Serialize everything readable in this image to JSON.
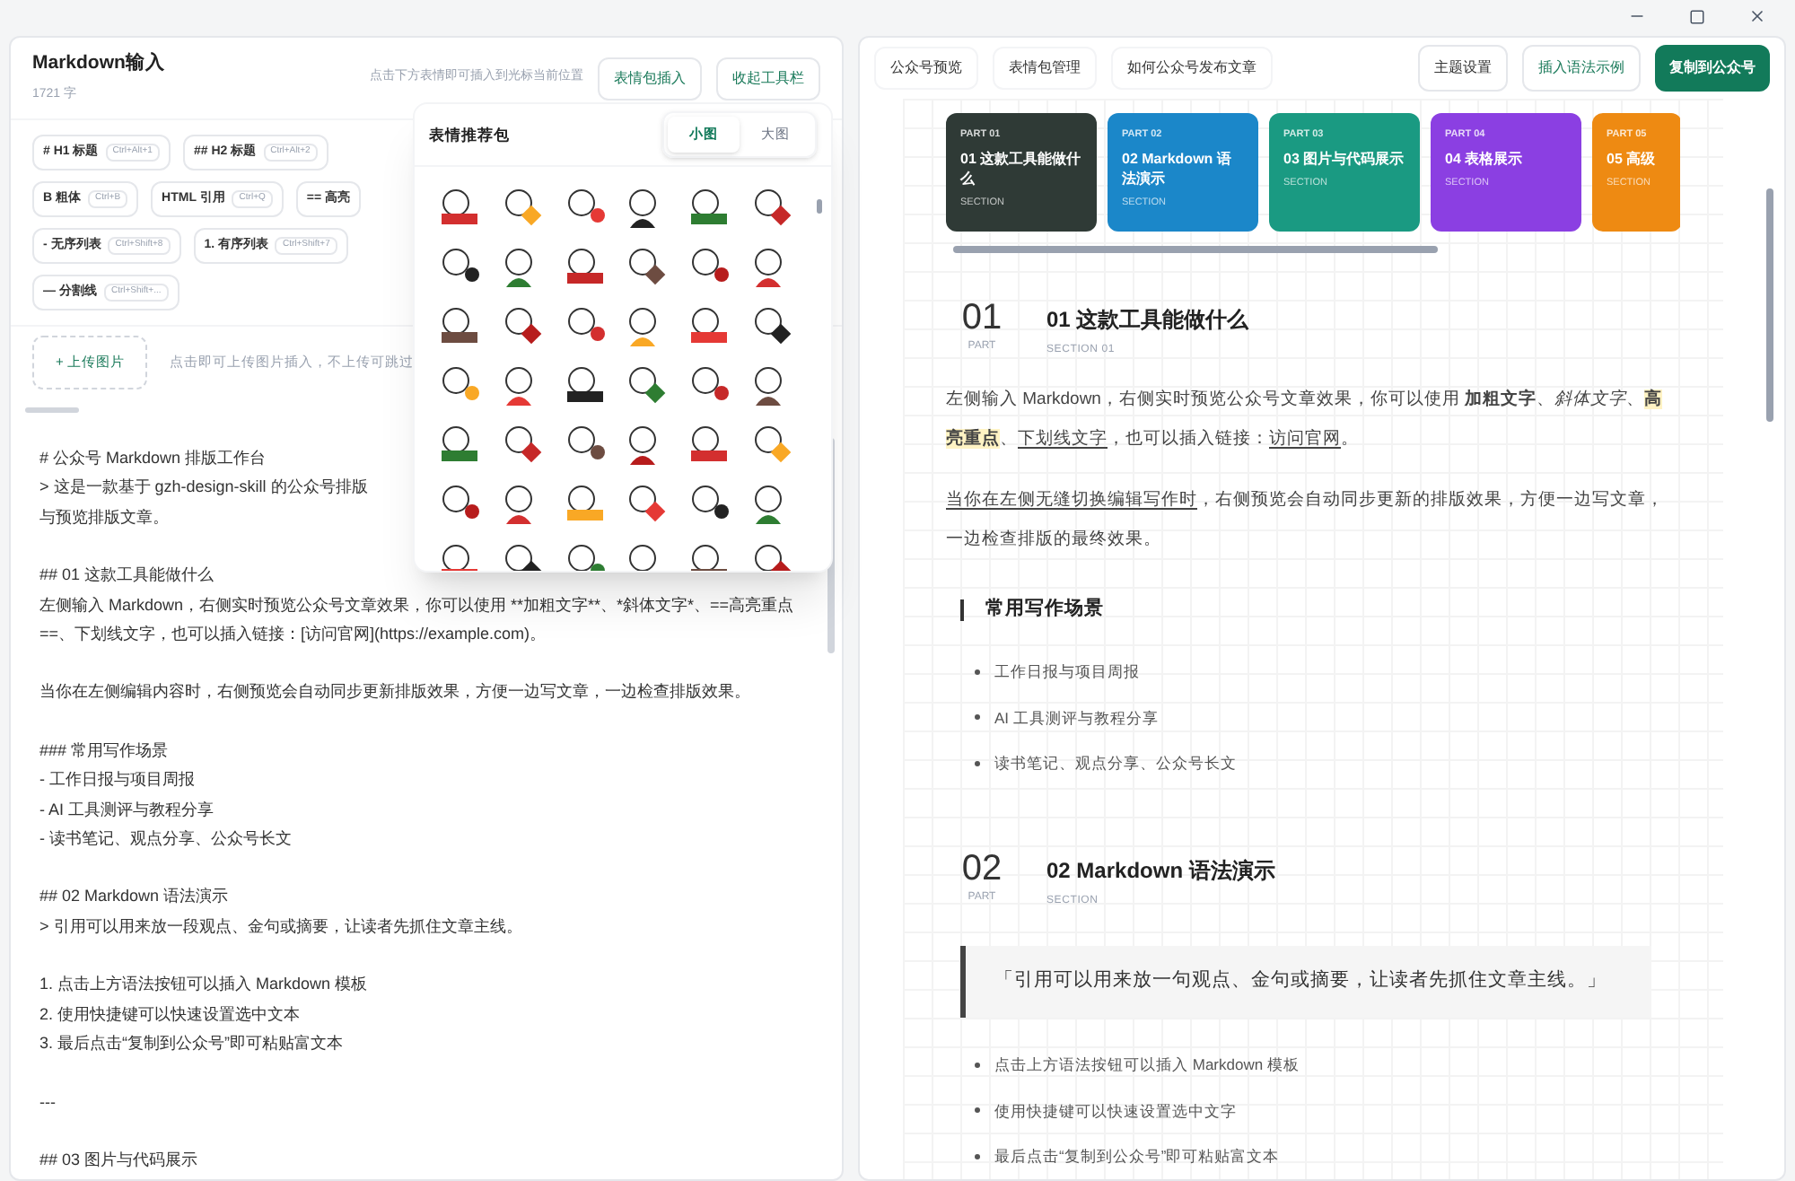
{
  "editor": {
    "title": "Markdown输入",
    "count": "1721 字",
    "hint": "点击下方表情即可插入到光标当前位置",
    "buttons": [
      {
        "label": "表情包插入"
      },
      {
        "label": "收起工具栏"
      }
    ],
    "tools": [
      [
        {
          "label": "# H1 标题",
          "shortcut": "Ctrl+Alt+1"
        },
        {
          "label": "## H2 标题",
          "shortcut": "Ctrl+Alt+2"
        }
      ],
      [
        {
          "label": "B 粗体",
          "shortcut": "Ctrl+B"
        },
        {
          "label": "HTML 引用",
          "shortcut": "Ctrl+Q"
        },
        {
          "label": "== 高亮"
        }
      ],
      [
        {
          "label": "- 无序列表",
          "shortcut": "Ctrl+Shift+8"
        },
        {
          "label": "1. 有序列表",
          "shortcut": "Ctrl+Shift+7"
        }
      ],
      [
        {
          "label": "— 分割线",
          "shortcut": "Ctrl+Shift+..."
        }
      ]
    ],
    "upload": {
      "button": "+ 上传图片",
      "hint": "点击即可上传图片插入，不上传可跳过"
    },
    "blocks": [
      [
        "# 公众号 Markdown 排版工作台",
        "> 这是一款基于 gzh-design-skill 的公众号排版",
        "与预览排版文章。"
      ],
      [
        "## 01 这款工具能做什么",
        "左侧输入 Markdown，右侧实时预览公众号文章效果，你可以使用 **加粗文字**、*斜体文字*、==高亮重点",
        "==、下划线文字，也可以插入链接：[访问官网](https://example.com)。"
      ],
      [
        "当你在左侧编辑内容时，右侧预览会自动同步更新排版效果，方便一边写文章，一边检查排版效果。"
      ],
      [
        "### 常用写作场景",
        "- 工作日报与项目周报",
        "- AI 工具测评与教程分享",
        "- 读书笔记、观点分享、公众号长文"
      ],
      [
        "## 02 Markdown 语法演示",
        "> 引用可以用来放一段观点、金句或摘要，让读者先抓住文章主线。"
      ],
      [
        "1. 点击上方语法按钮可以插入 Markdown 模板",
        "2. 使用快捷键可以快速设置选中文本",
        "3. 最后点击“复制到公众号”即可粘贴富文本"
      ],
      [
        "---"
      ],
      [
        "## 03 图片与代码展示"
      ]
    ]
  },
  "sticker_panel": {
    "title": "表情推荐包",
    "tabs": [
      {
        "label": "小图",
        "selected": true
      },
      {
        "label": "大图",
        "selected": false
      }
    ]
  },
  "preview": {
    "tabs": [
      {
        "label": "公众号预览"
      },
      {
        "label": "表情包管理"
      },
      {
        "label": "如何公众号发布文章"
      }
    ],
    "actions": [
      {
        "label": "主题设置",
        "kind": "plain"
      },
      {
        "label": "插入语法示例",
        "kind": "outline"
      },
      {
        "label": "复制到公众号",
        "kind": "primary"
      }
    ],
    "cards": [
      {
        "part": "PART 01",
        "title": "01 这款工具能做什么",
        "caption": "SECTION",
        "color": "#2f3a36"
      },
      {
        "part": "PART 02",
        "title": "02 Markdown 语法演示",
        "caption": "SECTION",
        "color": "#1b87c9"
      },
      {
        "part": "PART 03",
        "title": "03 图片与代码展示",
        "caption": "SECTION",
        "color": "#1a9a82"
      },
      {
        "part": "PART 04",
        "title": "04 表格展示",
        "caption": "SECTION",
        "color": "#8b3fe2"
      },
      {
        "part": "PART 05",
        "title": "05 高级",
        "caption": "SECTION",
        "color": "#ee8a12"
      }
    ],
    "sections": [
      {
        "number": "01",
        "number_caption": "PART",
        "title": "01 这款工具能做什么",
        "subtitle": "SECTION 01",
        "paragraphs": [
          [
            {
              "text": "左侧输入 Markdown，右侧实时预览公众号文章效果，你可以使用 ",
              "kind": "plain"
            },
            {
              "text": "加粗文字",
              "kind": "bold"
            },
            {
              "text": "、",
              "kind": "plain"
            },
            {
              "text": "斜体文字",
              "kind": "italic"
            },
            {
              "text": "、",
              "kind": "plain"
            },
            {
              "text": "高亮重点",
              "kind": "highlight"
            },
            {
              "text": "、",
              "kind": "plain"
            },
            {
              "text": "下划线文字",
              "kind": "underline"
            },
            {
              "text": "，也可以插入链接：",
              "kind": "plain"
            },
            {
              "text": "访问官网",
              "kind": "underline"
            },
            {
              "text": "。",
              "kind": "plain"
            }
          ],
          [
            {
              "text": "当你在左侧无缝切换编辑写作时",
              "kind": "underline"
            },
            {
              "text": "，右侧预览会自动同步更新的排版效果，方便一边写文章，一边检查排版的最终效果。",
              "kind": "plain"
            }
          ]
        ],
        "heading": "常用写作场景",
        "bullets": [
          "工作日报与项目周报",
          "AI 工具测评与教程分享",
          "读书笔记、观点分享、公众号长文"
        ]
      },
      {
        "number": "02",
        "number_caption": "PART",
        "title": "02 Markdown 语法演示",
        "subtitle": "SECTION",
        "quote": "「引用可以用来放一句观点、金句或摘要，让读者先抓住文章主线。」",
        "bullets": [
          "点击上方语法按钮可以插入 Markdown 模板",
          "使用快捷键可以快速设置选中文字",
          "最后点击“复制到公众号”即可粘贴富文本"
        ]
      }
    ]
  }
}
